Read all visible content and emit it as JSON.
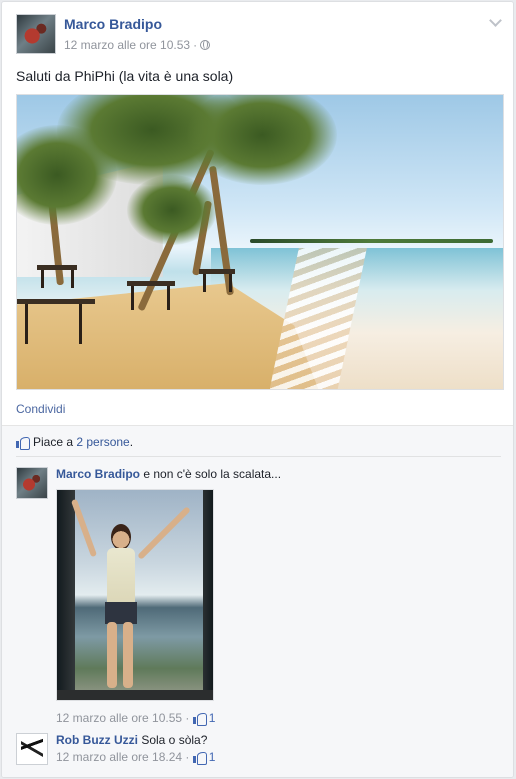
{
  "post": {
    "author": "Marco Bradipo",
    "timestamp": "12 marzo alle ore 10.53",
    "separator": "·",
    "privacy_icon": "globe-icon",
    "text": "Saluti da PhiPhi (la vita è una sola)",
    "share_label": "Condividi"
  },
  "likes": {
    "prefix": "Piace a ",
    "link": "2 persone",
    "suffix": "."
  },
  "comments": [
    {
      "author": "Marco Bradipo",
      "text": " e non c'è solo la scalata...",
      "timestamp": "12 marzo alle ore 10.55",
      "like_count": "1"
    },
    {
      "author": "Rob Buzz Uzzi",
      "text": " Sola o sòla?",
      "timestamp": "12 marzo alle ore 18.24",
      "like_count": "1"
    }
  ],
  "colors": {
    "link": "#365899",
    "meta": "#90949c",
    "background": "#e9ebee"
  }
}
